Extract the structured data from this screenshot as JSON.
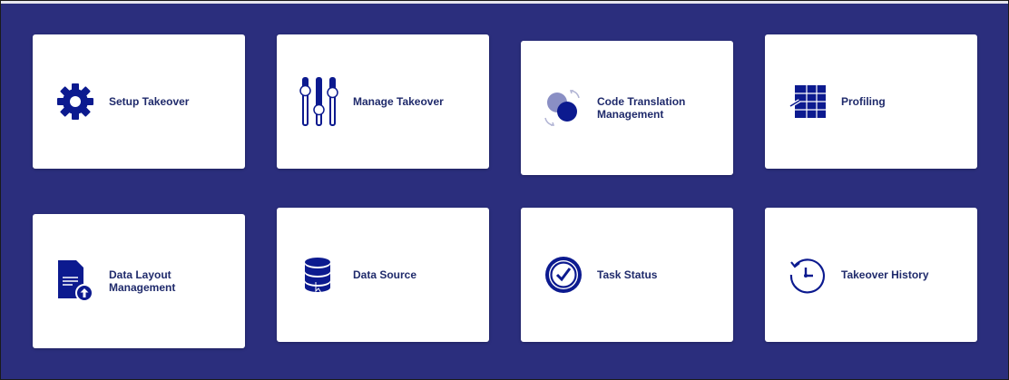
{
  "tiles": [
    {
      "label": "Setup Takeover",
      "icon": "gear-icon"
    },
    {
      "label": "Manage Takeover",
      "icon": "sliders-icon"
    },
    {
      "label": "Code Translation\nManagement",
      "icon": "code-translation-icon"
    },
    {
      "label": "Profiling",
      "icon": "table-profile-icon"
    },
    {
      "label": "Data Layout\nManagement",
      "icon": "document-upload-icon"
    },
    {
      "label": "Data Source",
      "icon": "database-icon"
    },
    {
      "label": "Task Status",
      "icon": "check-circle-icon"
    },
    {
      "label": "Takeover History",
      "icon": "history-icon"
    }
  ],
  "colors": {
    "background": "#2b2e7d",
    "tile": "#ffffff",
    "icon": "#0c1a8f",
    "label": "#1f2a6b"
  }
}
